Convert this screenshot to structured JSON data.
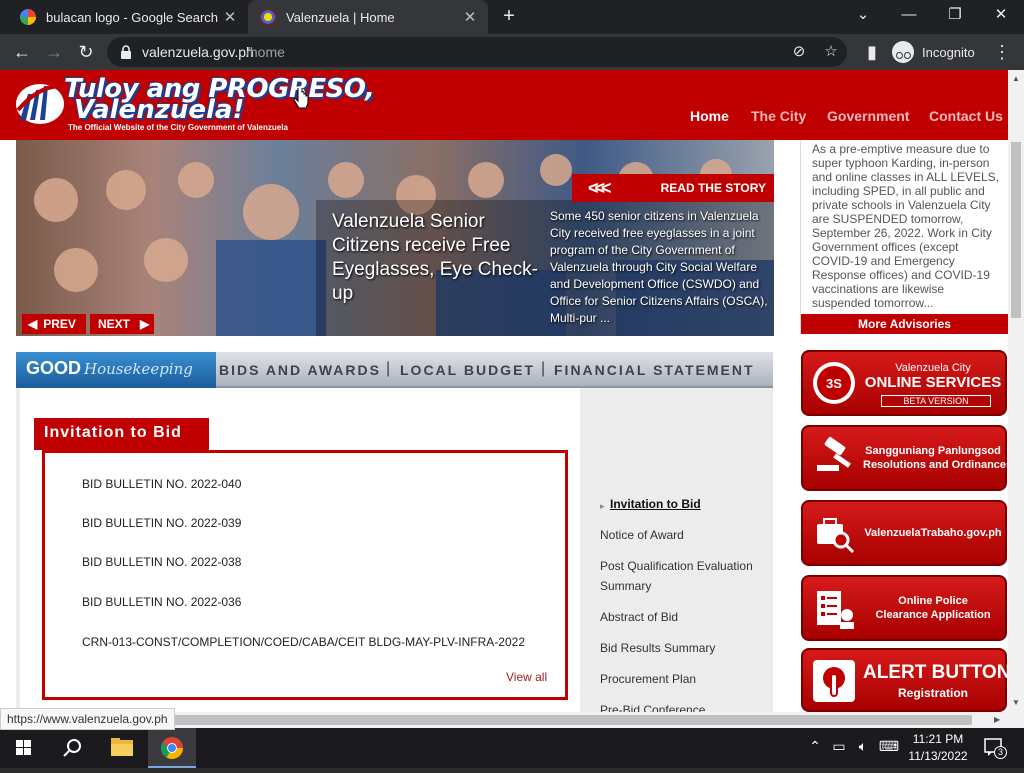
{
  "browser": {
    "tabs": [
      {
        "title": "bulacan logo - Google Search",
        "active": false
      },
      {
        "title": "Valenzuela | Home",
        "active": true
      }
    ],
    "url_host": "valenzuela.gov.ph",
    "url_path": "/home",
    "incognito_label": "Incognito",
    "status_url": "https://www.valenzuela.gov.ph"
  },
  "site": {
    "logo_line1": "Tuloy ang PROGRESO,",
    "logo_line2": "Valenzuela!",
    "logo_tagline": "The Official Website of the City Government of Valenzuela",
    "nav": [
      "Home",
      "The City",
      "Government",
      "Contact Us"
    ]
  },
  "hero": {
    "read_story": "READ THE STORY",
    "read_arrows": "<<<",
    "title": "Valenzuela Senior Citizens receive Free Eyeglasses, Eye Check-up",
    "summary": "Some 450 senior citizens in Valenzuela City received free eyeglasses in a joint program of the City Government of Valenzuela through City Social Welfare and Development Office (CSWDO) and Office for Senior Citizens Affairs (OSCA), Multi-pur ...",
    "prev": "PREV",
    "next": "NEXT"
  },
  "advisory": {
    "text": "As a pre-emptive measure due to super typhoon Karding, in-person and online classes in ALL LEVELS, including SPED, in all public and private schools in Valenzuela City are SUSPENDED tomorrow, September 26, 2022. Work in City Government offices (except COVID-19 and Emergency Response offices) and COVID-19 vaccinations are likewise suspended tomorrow...",
    "more": "More Advisories"
  },
  "housekeeping": {
    "good": "GOOD",
    "house": "Housekeeping",
    "links": [
      "BIDS AND AWARDS",
      "LOCAL BUDGET",
      "FINANCIAL STATEMENT"
    ],
    "separator": "|"
  },
  "bids": {
    "heading": "Invitation to Bid",
    "items": [
      "BID BULLETIN NO. 2022-040",
      "BID BULLETIN NO. 2022-039",
      "BID BULLETIN NO. 2022-038",
      "BID BULLETIN NO. 2022-036",
      "CRN-013-CONST/COMPLETION/COED/CABA/CEIT BLDG-MAY-PLV-INFRA-2022"
    ],
    "view_all": "View all",
    "side_links": [
      "Invitation to Bid",
      "Notice of Award",
      "Post Qualification Evaluation Summary",
      "Abstract of Bid",
      "Bid Results Summary",
      "Procurement Plan",
      "Pre-Bid Conference"
    ]
  },
  "services": [
    {
      "line1": "Valenzuela City",
      "line2": "ONLINE SERVICES",
      "line3": "BETA VERSION",
      "icon": "services-globe-icon"
    },
    {
      "line1": "Sangguniang Panlungsod",
      "line2": "Resolutions and Ordinances",
      "icon": "gavel-icon"
    },
    {
      "line1": "ValenzuelaTrabaho.gov.ph",
      "icon": "briefcase-search-icon"
    },
    {
      "line1": "Online Police",
      "line2": "Clearance Application",
      "icon": "clearance-form-icon"
    },
    {
      "line1": "ALERT BUTTON",
      "line2": "Registration",
      "icon": "alert-hand-icon"
    }
  ],
  "taskbar": {
    "time": "11:21 PM",
    "date": "11/13/2022",
    "notifications": "3"
  },
  "colors": {
    "brand_red": "#c00000",
    "chrome_dark": "#202124",
    "chrome_toolbar": "#35363a"
  }
}
